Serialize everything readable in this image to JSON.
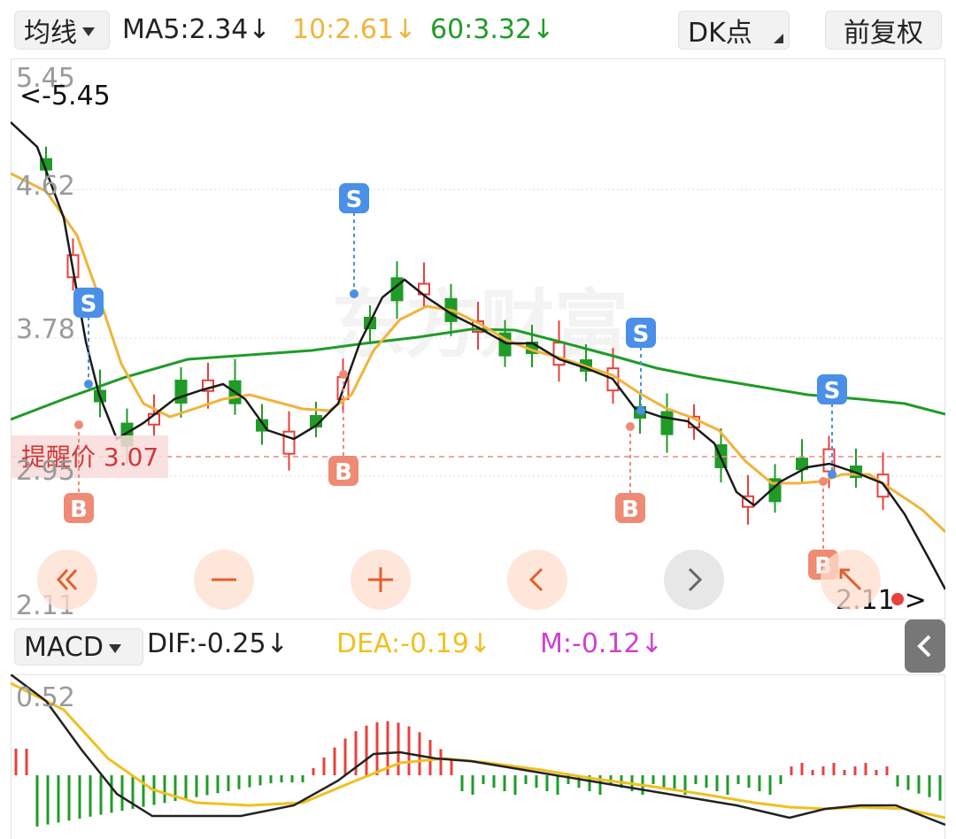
{
  "toolbar": {
    "ma_selector": "均线",
    "ma5_label": "MA5:2.34",
    "ma10_label": "10:2.61",
    "ma60_label": "60:3.32",
    "dk_button": "DK点",
    "adjust_button": "前复权"
  },
  "price_axis": {
    "top": "5.45",
    "upper": "4.62",
    "middle": "3.78",
    "lower": "2.95",
    "bottom": "2.11"
  },
  "annotations": {
    "high_marker": "<-5.45",
    "low_marker": "2.11->",
    "alert_price_label": "提醒价 3.07",
    "watermark": "东方财富"
  },
  "signals": {
    "sell": "S",
    "buy": "B"
  },
  "macd_bar": {
    "selector": "MACD",
    "dif_label": "DIF:-0.25",
    "dea_label": "DEA:-0.19",
    "m_label": "M:-0.12",
    "axis_top": "0.52"
  },
  "colors": {
    "up": "#e8413c",
    "down": "#1f9b27",
    "ma5": "#1a1a1a",
    "ma10": "#f0b43a",
    "ma60": "#1f9b27",
    "dea": "#f0c020",
    "m": "#d040d0",
    "sell_badge": "#4a8fe8",
    "buy_badge": "#ef8a74"
  },
  "controls": {
    "first_icon": "double-chevron-left-icon",
    "zoom_out_icon": "minus-icon",
    "zoom_in_icon": "plus-icon",
    "prev_icon": "chevron-left-icon",
    "next_icon": "chevron-right-icon",
    "side_panel_icon": "chevron-left-icon"
  }
}
